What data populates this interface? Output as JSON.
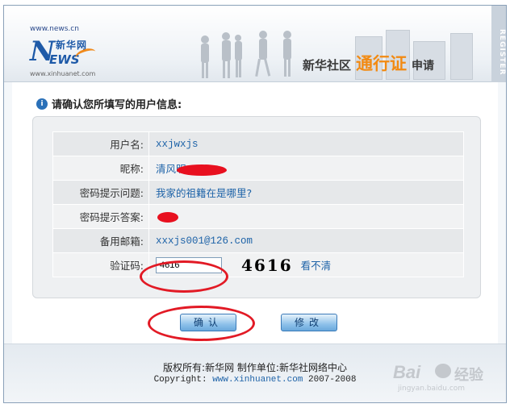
{
  "header": {
    "logo_url": "www.news.cn",
    "logo_n": "N",
    "logo_cn": "新华网",
    "logo_ews": "EWS",
    "logo_sub": "www.xinhuanet.com",
    "title_prefix": "新华社区",
    "title_highlight": "通行证",
    "title_suffix": "申请",
    "side_label": "REGISTER"
  },
  "section": {
    "icon": "i",
    "title": "请确认您所填写的用户信息:"
  },
  "fields": [
    {
      "label": "用户名:",
      "value": "xxjwxjs"
    },
    {
      "label": "昵称:",
      "value": "清风明"
    },
    {
      "label": "密码提示问题:",
      "value": "我家的祖籍在是哪里?"
    },
    {
      "label": "密码提示答案:",
      "value": ""
    },
    {
      "label": "备用邮箱:",
      "value": "xxxjs001@126.com"
    }
  ],
  "captcha": {
    "label": "验证码:",
    "input_value": "4616",
    "image_text": "4616",
    "refresh_link": "看不清"
  },
  "buttons": {
    "confirm": "确认",
    "modify": "修改"
  },
  "footer": {
    "line1": "版权所有:新华网   制作单位:新华社网络中心",
    "copyright_prefix": "Copyright: ",
    "copyright_link": "www.xinhuanet.com",
    "copyright_suffix": " 2007-2008"
  },
  "watermark": {
    "brand": "Bai",
    "suffix": "经验",
    "url": "jingyan.baidu.com"
  },
  "colors": {
    "accent_blue": "#1e63a8",
    "highlight_orange": "#f28a12",
    "annotation_red": "#e21a25"
  }
}
